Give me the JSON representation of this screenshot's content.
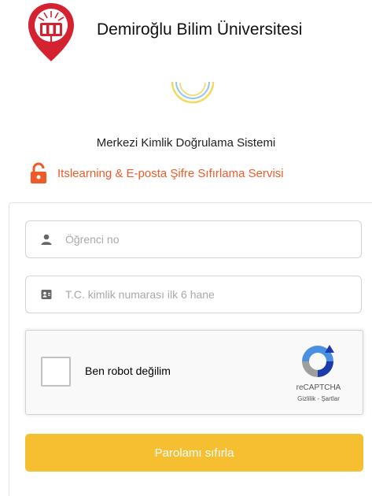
{
  "header": {
    "university_name": "Demiroğlu Bilim Üniversitesi",
    "logo_icon": "university-seal-icon"
  },
  "loading": {
    "icon": "loading-spinner-icon"
  },
  "system": {
    "title": "Merkezi Kimlik Doğrulama Sistemi",
    "service_title": "Itslearning & E-posta Şifre Sıfırlama Servisi",
    "service_icon": "lock-open-icon"
  },
  "form": {
    "student_no": {
      "placeholder": "Öğrenci no",
      "value": "",
      "icon": "user-icon"
    },
    "tc_id": {
      "placeholder": "T.C. kimlik numarası ilk 6 hane",
      "value": "",
      "icon": "id-card-icon"
    },
    "recaptcha": {
      "label": "Ben robot değilim",
      "brand": "reCAPTCHA",
      "privacy_link": "Gizlilik",
      "separator": " - ",
      "terms_link": "Şartlar",
      "checked": false
    },
    "submit_label": "Parolamı sıfırla"
  },
  "colors": {
    "accent_orange": "#f05a28",
    "button_yellow": "#f6bf32",
    "brand_red": "#d42230",
    "spinner_yellow": "#f0d95c",
    "spinner_blue": "#8fc7e6"
  }
}
